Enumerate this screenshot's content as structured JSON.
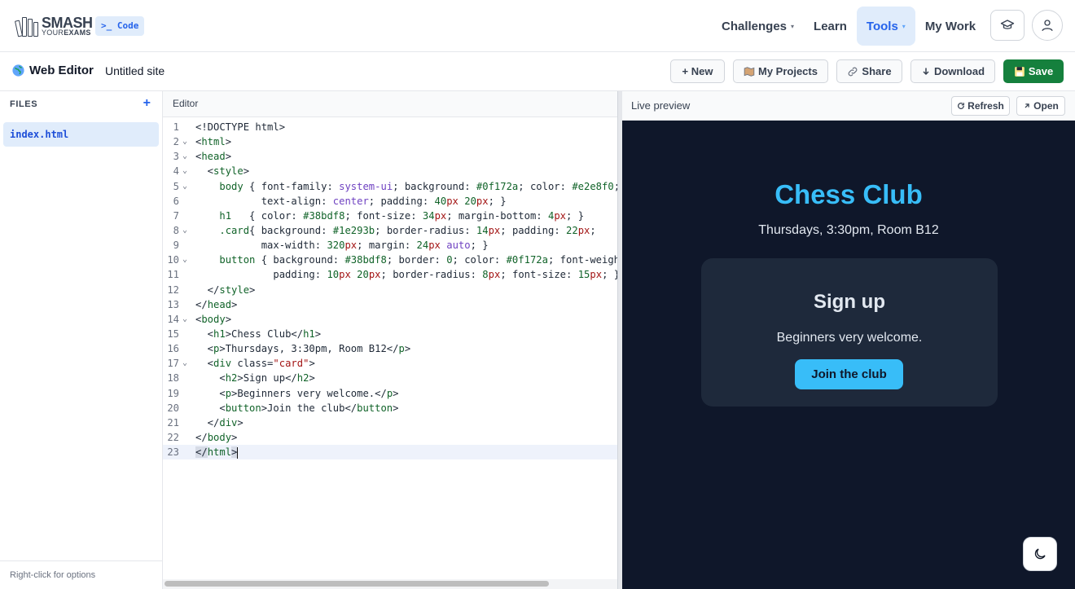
{
  "nav": {
    "logo_main": "SMASH",
    "logo_sub_a": "YOUR",
    "logo_sub_b": "EXAMS",
    "badge": ">_ Code",
    "links": [
      {
        "label": "Challenges",
        "caret": "▾"
      },
      {
        "label": "Learn"
      },
      {
        "label": "Tools",
        "caret": "▾"
      },
      {
        "label": "My Work"
      }
    ],
    "icons": [
      "graduation-cap-icon",
      "user-icon"
    ]
  },
  "toolbar": {
    "title": "Web Editor",
    "site_name": "Untitled site",
    "new_label": "+ New",
    "projects_label": "My Projects",
    "share_label": "Share",
    "download_label": "Download",
    "save_label": "Save"
  },
  "sidebar": {
    "heading": "FILES",
    "add": "+",
    "files": [
      "index.html"
    ],
    "footer": "Right-click for options"
  },
  "editor": {
    "title": "Editor",
    "current_line": 23
  },
  "preview": {
    "title": "Live preview",
    "refresh_label": "Refresh",
    "open_label": "Open",
    "h1": "Chess Club",
    "subtitle": "Thursdays, 3:30pm, Room B12",
    "card_title": "Sign up",
    "card_text": "Beginners very welcome.",
    "button_label": "Join the club",
    "bg": "#0f172a",
    "accent": "#38bdf8",
    "card_bg": "#1e293b"
  },
  "colors": {
    "brand_blue": "#2563eb",
    "save_green": "#15803d"
  }
}
